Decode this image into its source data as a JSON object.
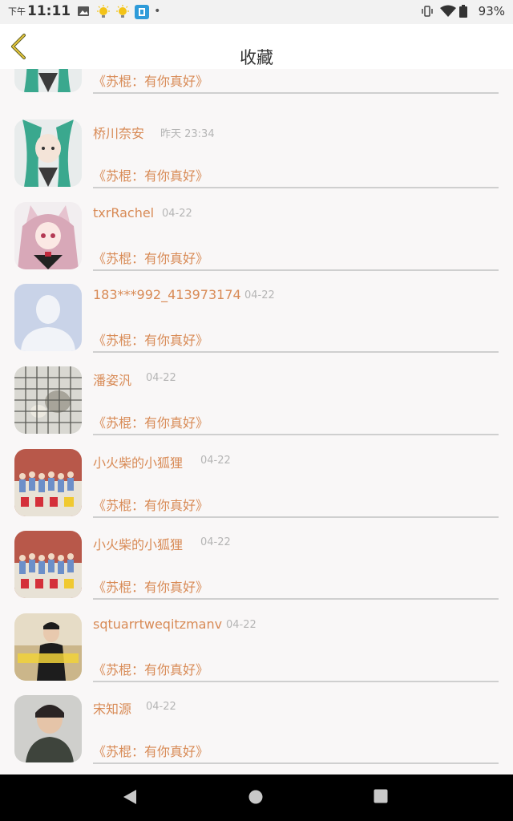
{
  "status_bar": {
    "time_prefix": "下午",
    "time": "11:11",
    "battery": "93%"
  },
  "header": {
    "title": "收藏",
    "back_icon": "chevron-left-icon"
  },
  "items": [
    {
      "name": "",
      "time": "",
      "quote": "《苏棍：有你真好》",
      "avatar": "anime-green-hair"
    },
    {
      "name": "桥川奈安",
      "time": "昨天 23:34",
      "quote": "《苏棍：有你真好》",
      "avatar": "anime-green-hair"
    },
    {
      "name": "txrRachel",
      "time": "04-22",
      "quote": "《苏棍：有你真好》",
      "avatar": "anime-cat-ears"
    },
    {
      "name": "183***992_413973174",
      "time": "04-22",
      "quote": "《苏棍：有你真好》",
      "avatar": "default-person"
    },
    {
      "name": "潘姿汎",
      "time": "04-22",
      "quote": "《苏棍：有你真好》",
      "avatar": "cage-cat"
    },
    {
      "name": "小火柴的小狐狸",
      "time": "04-22",
      "quote": "《苏棍：有你真好》",
      "avatar": "group-photo"
    },
    {
      "name": "小火柴的小狐狸",
      "time": "04-22",
      "quote": "《苏棍：有你真好》",
      "avatar": "group-photo"
    },
    {
      "name": "sqtuarrtweqitzmanv",
      "time": "04-22",
      "quote": "《苏棍：有你真好》",
      "avatar": "person-field"
    },
    {
      "name": "宋知源",
      "time": "04-22",
      "quote": "《苏棍：有你真好》",
      "avatar": "person-portrait"
    }
  ],
  "nav_bar": {
    "back": "triangle-back-icon",
    "home": "circle-home-icon",
    "recents": "square-recents-icon"
  }
}
